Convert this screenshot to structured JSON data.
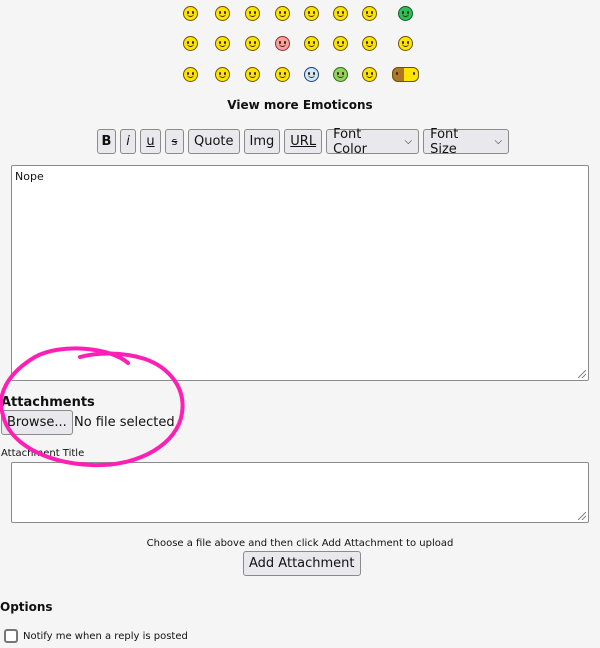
{
  "emoticons": {
    "rows": [
      [
        "smile-grin-icon",
        "laugh-icon",
        "smile-icon",
        "confused-icon",
        "sad-icon",
        "puzzled-icon",
        "glasses-nerd-icon",
        "green-grin-icon"
      ],
      [
        "cool-sunglasses-icon",
        "cheesy-icon",
        "shocked-icon",
        "blush-icon",
        "devil-icon",
        "angry-devil-icon",
        "rolleyes-icon",
        "big-smile-icon"
      ],
      [
        "big-mouth-icon",
        "tongue-icon",
        "surprised-icon",
        "waving-icon",
        "dizzy-icon",
        "sick-icon",
        "thinking-icon",
        "group-icon"
      ]
    ],
    "view_more_label": "View more Emoticons"
  },
  "toolbar": {
    "bold_label": "B",
    "italic_label": "i",
    "underline_label": "u",
    "strike_label": "s",
    "quote_label": "Quote",
    "img_label": "Img",
    "url_label": "URL",
    "font_color_label": "Font Color",
    "font_size_label": "Font Size"
  },
  "message": {
    "value": "Nope"
  },
  "attachments": {
    "heading": "Attachments",
    "browse_label": "Browse...",
    "file_status": "No file selected",
    "title_label": "Attachment Title",
    "title_value": "",
    "hint": "Choose a file above and then click Add Attachment to upload",
    "add_label": "Add Attachment"
  },
  "options": {
    "heading": "Options",
    "notify_label": "Notify me when a reply is posted",
    "notify_checked": false
  },
  "colors": {
    "annotation_circle": "#ff1fb4",
    "button_bg": "#e9e9ed",
    "page_bg": "#f5f5f5"
  }
}
